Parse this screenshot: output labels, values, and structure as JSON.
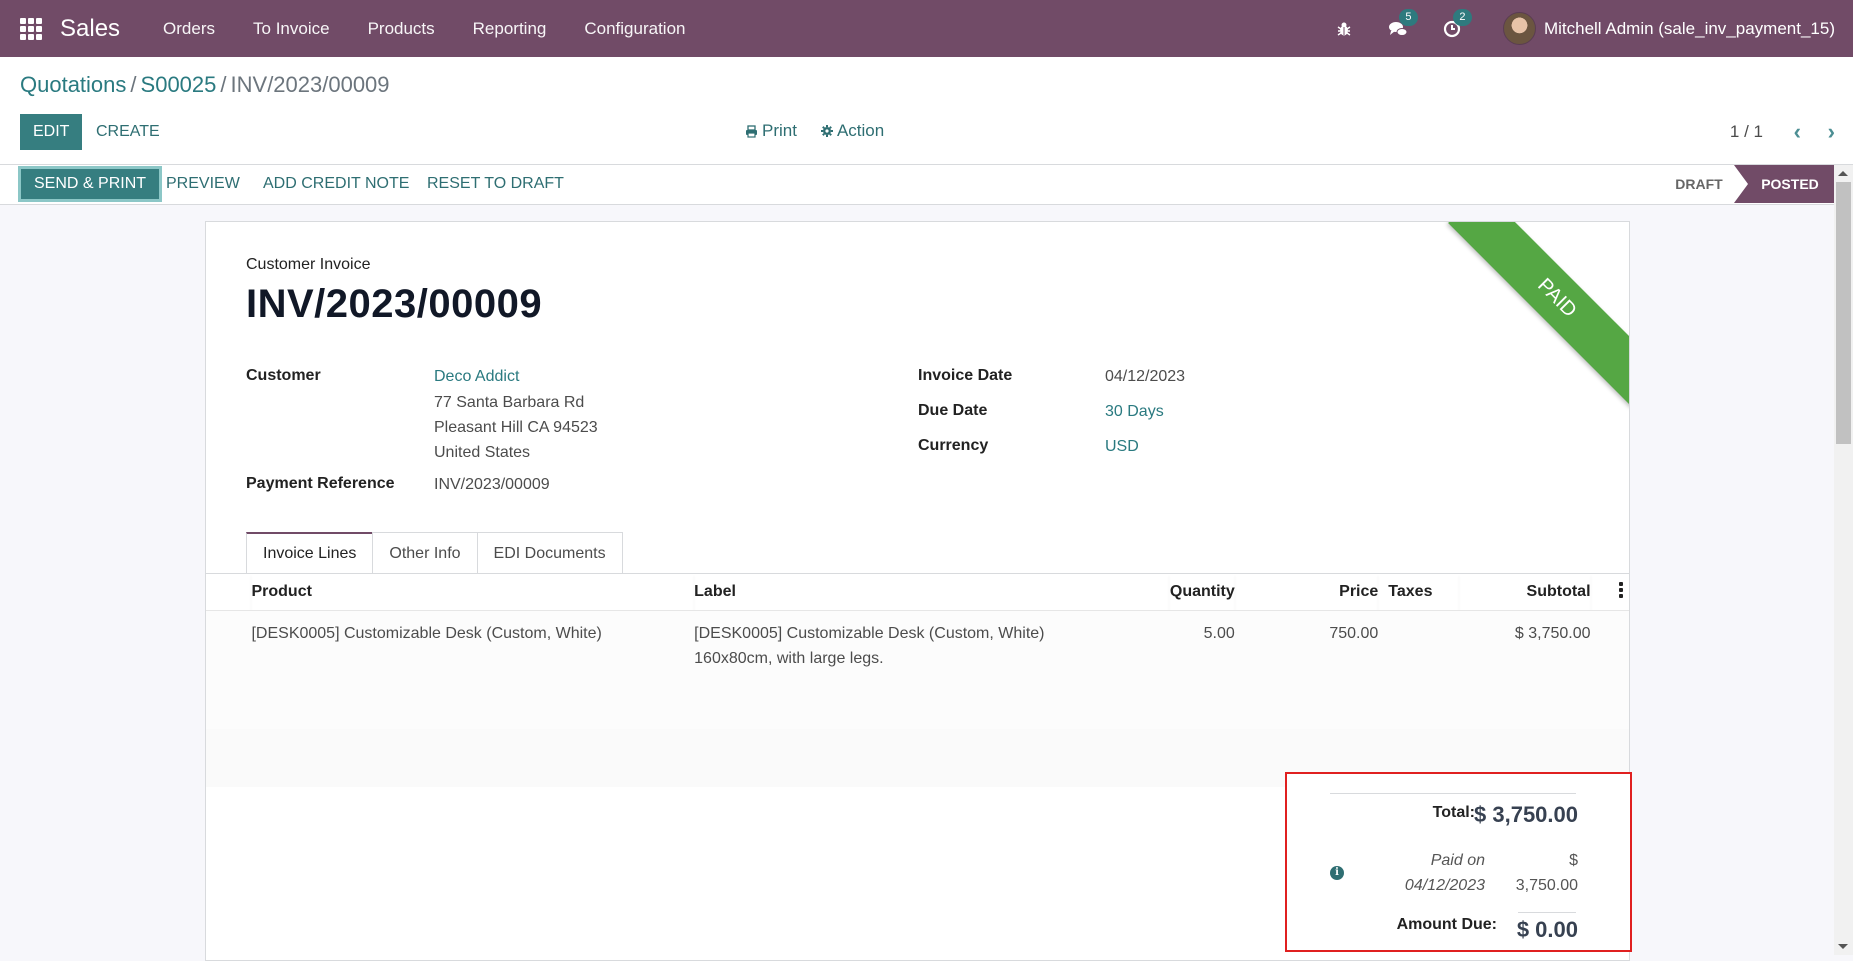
{
  "topbar": {
    "app_name": "Sales",
    "menu": [
      "Orders",
      "To Invoice",
      "Products",
      "Reporting",
      "Configuration"
    ],
    "messages_count": "5",
    "activities_count": "2",
    "user": "Mitchell Admin (sale_inv_payment_15)",
    "brand_color": "#714b67"
  },
  "breadcrumb": {
    "items": [
      "Quotations",
      "S00025"
    ],
    "current": "INV/2023/00009",
    "separator": "/"
  },
  "control": {
    "edit_label": "EDIT",
    "create_label": "CREATE",
    "print_label": "Print",
    "action_label": "Action",
    "pager": "1 / 1"
  },
  "statusbar": {
    "buttons": [
      "SEND & PRINT",
      "PREVIEW",
      "ADD CREDIT NOTE",
      "RESET TO DRAFT"
    ],
    "stages": [
      "DRAFT",
      "POSTED"
    ],
    "active_stage": "POSTED"
  },
  "invoice": {
    "ribbon": "PAID",
    "type": "Customer Invoice",
    "name": "INV/2023/00009",
    "fields": {
      "customer_label": "Customer",
      "customer": "Deco Addict",
      "address": [
        "77 Santa Barbara Rd",
        "Pleasant Hill CA 94523",
        "United States"
      ],
      "payment_ref_label": "Payment Reference",
      "payment_ref": "INV/2023/00009",
      "invoice_date_label": "Invoice Date",
      "invoice_date": "04/12/2023",
      "due_date_label": "Due Date",
      "due_date": "30 Days",
      "currency_label": "Currency",
      "currency": "USD"
    },
    "tabs": [
      "Invoice Lines",
      "Other Info",
      "EDI Documents"
    ],
    "columns": [
      "Product",
      "Label",
      "Quantity",
      "Price",
      "Taxes",
      "Subtotal"
    ],
    "lines": [
      {
        "product": "[DESK0005] Customizable Desk (Custom, White)",
        "label_1": "[DESK0005] Customizable Desk (Custom, White)",
        "label_2": "160x80cm, with large legs.",
        "quantity": "5.00",
        "price": "750.00",
        "taxes": "",
        "subtotal": "$ 3,750.00"
      }
    ],
    "totals": {
      "total_label": "Total:",
      "total": "$ 3,750.00",
      "paid_on_1": "Paid on",
      "paid_on_2": "04/12/2023",
      "paid_amount_1": "$",
      "paid_amount_2": "3,750.00",
      "amount_due_label": "Amount Due:",
      "amount_due": "$ 0.00"
    }
  }
}
